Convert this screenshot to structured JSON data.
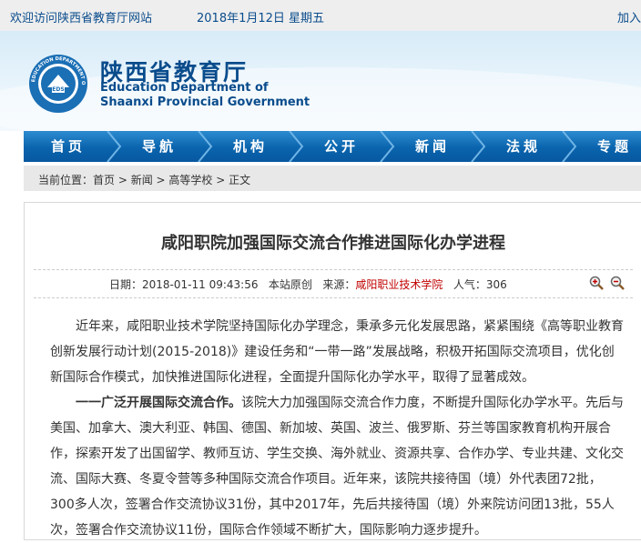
{
  "topbar": {
    "welcome": "欢迎访问陕西省教育厅网站",
    "date": "2018年1月12日 星期五",
    "favorite": "加入"
  },
  "header": {
    "title_cn": "陕西省教育厅",
    "title_en_1": "Education Department of",
    "title_en_2": "Shaanxi Provincial Government",
    "logo_text": "EDUCATION DEPARTMENT OF SHAANXI",
    "logo_center": "EDS"
  },
  "nav": {
    "items": [
      "首页",
      "导航",
      "机构",
      "公开",
      "新闻",
      "法规",
      "专题"
    ]
  },
  "breadcrumb": {
    "label": "当前位置：",
    "items": [
      "首页",
      "新闻",
      "高等学校",
      "正文"
    ],
    "sep": " > "
  },
  "article": {
    "title": "咸阳职院加强国际交流合作推进国际化办学进程",
    "meta_date_label": "日期：",
    "meta_date": "2018-01-11 09:43:56",
    "meta_original": "本站原创",
    "meta_source_label": "来源：",
    "meta_source": "咸阳职业技术学院",
    "meta_views_label": "人气：",
    "meta_views": "306",
    "para1": "近年来，咸阳职业技术学院坚持国际化办学理念，秉承多元化发展思路，紧紧围绕《高等职业教育创新发展行动计划(2015-2018)》建设任务和“一带一路”发展战略，积极开拓国际交流项目，优化创新国际合作模式，加快推进国际化进程，全面提升国际化办学水平，取得了显著成效。",
    "para2_bold": "一一广泛开展国际交流合作。",
    "para2": "该院大力加强国际交流合作力度，不断提升国际化办学水平。先后与美国、加拿大、澳大利亚、韩国、德国、新加坡、英国、波兰、俄罗斯、芬兰等国家教育机构开展合作，探索开发了出国留学、教师互访、学生交换、海外就业、资源共享、合作办学、专业共建、文化交流、国际大赛、冬夏令营等多种国际交流合作项目。近年来，该院共接待国（境）外代表团72批，300多人次，签署合作交流协议31份，其中2017年，先后共接待国（境）外来院访问团13批，55人次，签署合作交流协议11份，国际合作领域不断扩大，国际影响力逐步提升。"
  },
  "colors": {
    "brand": "#0a4c8c",
    "nav": "#0a64ad",
    "source": "#c00000"
  }
}
